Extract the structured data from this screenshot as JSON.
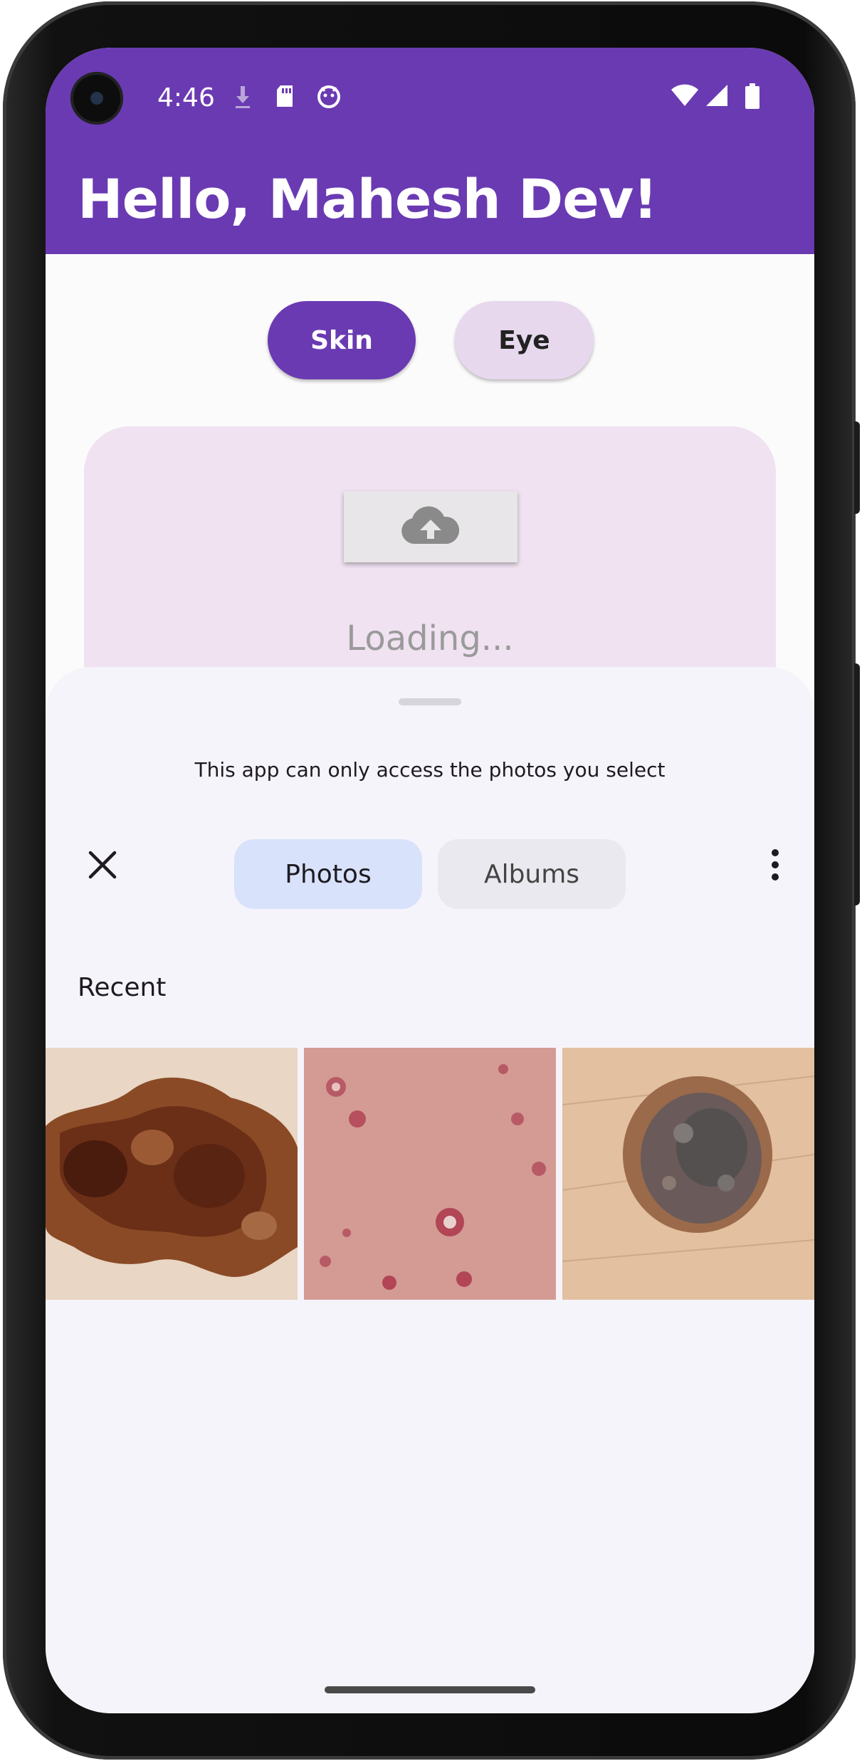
{
  "status_bar": {
    "time": "4:46",
    "left_icons": [
      "download-icon",
      "sd-card-icon",
      "android-face-icon"
    ],
    "right_icons": [
      "wifi-icon",
      "signal-icon",
      "battery-icon"
    ]
  },
  "header": {
    "greeting": "Hello, Mahesh Dev!",
    "color": "#6a3ab2"
  },
  "mode_chips": [
    {
      "label": "Skin",
      "selected": true
    },
    {
      "label": "Eye",
      "selected": false
    }
  ],
  "upload": {
    "icon": "cloud-upload-icon",
    "status_text": "Loading..."
  },
  "photo_picker": {
    "notice": "This app can only access the photos you select",
    "close_icon": "close-icon",
    "tabs": [
      {
        "label": "Photos",
        "selected": true
      },
      {
        "label": "Albums",
        "selected": false
      }
    ],
    "more_icon": "more-vert-icon",
    "section_title": "Recent",
    "photos": [
      {
        "name": "skin-lesion-photo-1"
      },
      {
        "name": "skin-rash-photo-2"
      },
      {
        "name": "skin-mole-photo-3"
      }
    ]
  }
}
